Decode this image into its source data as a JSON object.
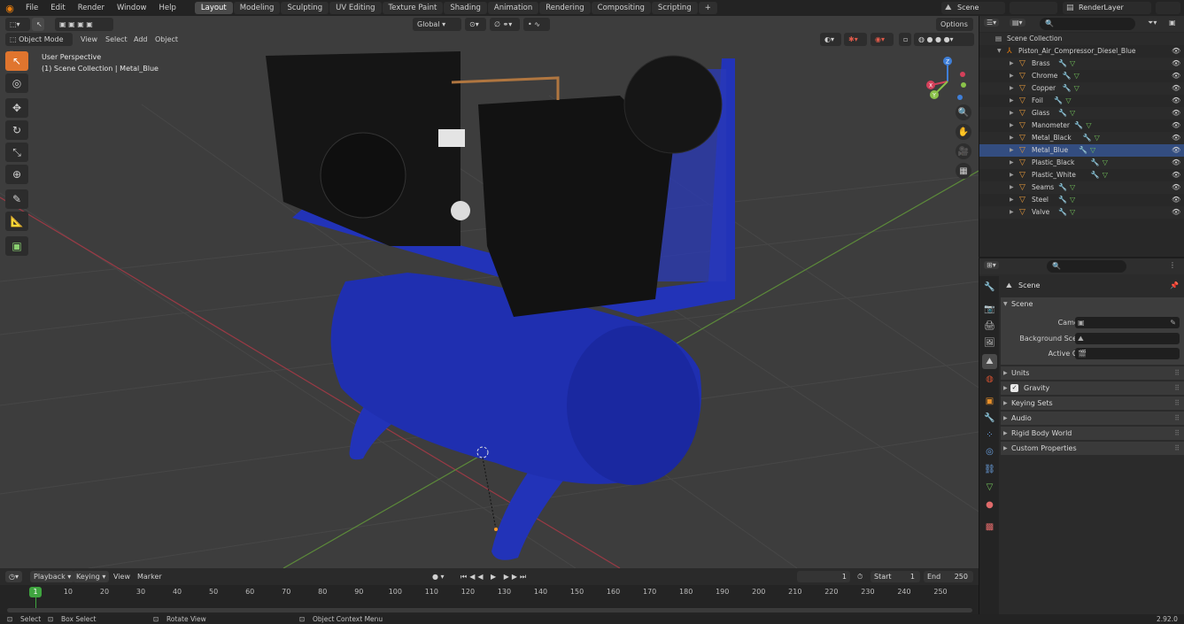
{
  "menu": [
    "File",
    "Edit",
    "Render",
    "Window",
    "Help"
  ],
  "workspace_tabs": [
    "Layout",
    "Modeling",
    "Sculpting",
    "UV Editing",
    "Texture Paint",
    "Shading",
    "Animation",
    "Rendering",
    "Compositing",
    "Scripting"
  ],
  "active_workspace": "Layout",
  "scene_field": "Scene",
  "render_layer_field": "RenderLayer",
  "viewport": {
    "mode": "Object Mode",
    "menus": [
      "View",
      "Select",
      "Add",
      "Object"
    ],
    "orientation": "Global",
    "options_label": "Options",
    "info_line1": "User Perspective",
    "info_line2": "(1) Scene Collection | Metal_Blue",
    "gizmo_axes": {
      "x": "X",
      "y": "Y",
      "z": "Z"
    }
  },
  "timeline": {
    "playback": "Playback",
    "keying": "Keying",
    "view": "View",
    "marker": "Marker",
    "current_frame": "1",
    "start_label": "Start",
    "start": "1",
    "end_label": "End",
    "end": "250",
    "ticks": [
      "1",
      "10",
      "20",
      "30",
      "40",
      "50",
      "60",
      "70",
      "80",
      "90",
      "100",
      "110",
      "120",
      "130",
      "140",
      "150",
      "160",
      "170",
      "180",
      "190",
      "200",
      "210",
      "220",
      "230",
      "240",
      "250"
    ]
  },
  "status": {
    "select": "Select",
    "box_select": "Box Select",
    "rotate_view": "Rotate View",
    "context_menu": "Object Context Menu",
    "version": "2.92.0"
  },
  "outliner": {
    "root": "Scene Collection",
    "object": "Piston_Air_Compressor_Diesel_Blue",
    "materials": [
      "Brass",
      "Chrome",
      "Copper",
      "Foil",
      "Glass",
      "Manometer",
      "Metal_Black",
      "Metal_Blue",
      "Plastic_Black",
      "Plastic_White",
      "Seams",
      "Steel",
      "Valve"
    ],
    "selected_material": "Metal_Blue"
  },
  "properties": {
    "context": "Scene",
    "panel_open": "Scene",
    "camera_label": "Camera",
    "background_scene_label": "Background Scene",
    "active_clip_label": "Active Clip",
    "closed_panels": [
      "Units",
      "Gravity",
      "Keying Sets",
      "Audio",
      "Rigid Body World",
      "Custom Properties"
    ]
  },
  "colors": {
    "accent_orange": "#e0752e",
    "frame_green": "#3fa53f",
    "axis_x": "#d4405a",
    "axis_y": "#8ac24a",
    "axis_z": "#3f7fd8",
    "compressor_blue": "#1f2fb0"
  }
}
